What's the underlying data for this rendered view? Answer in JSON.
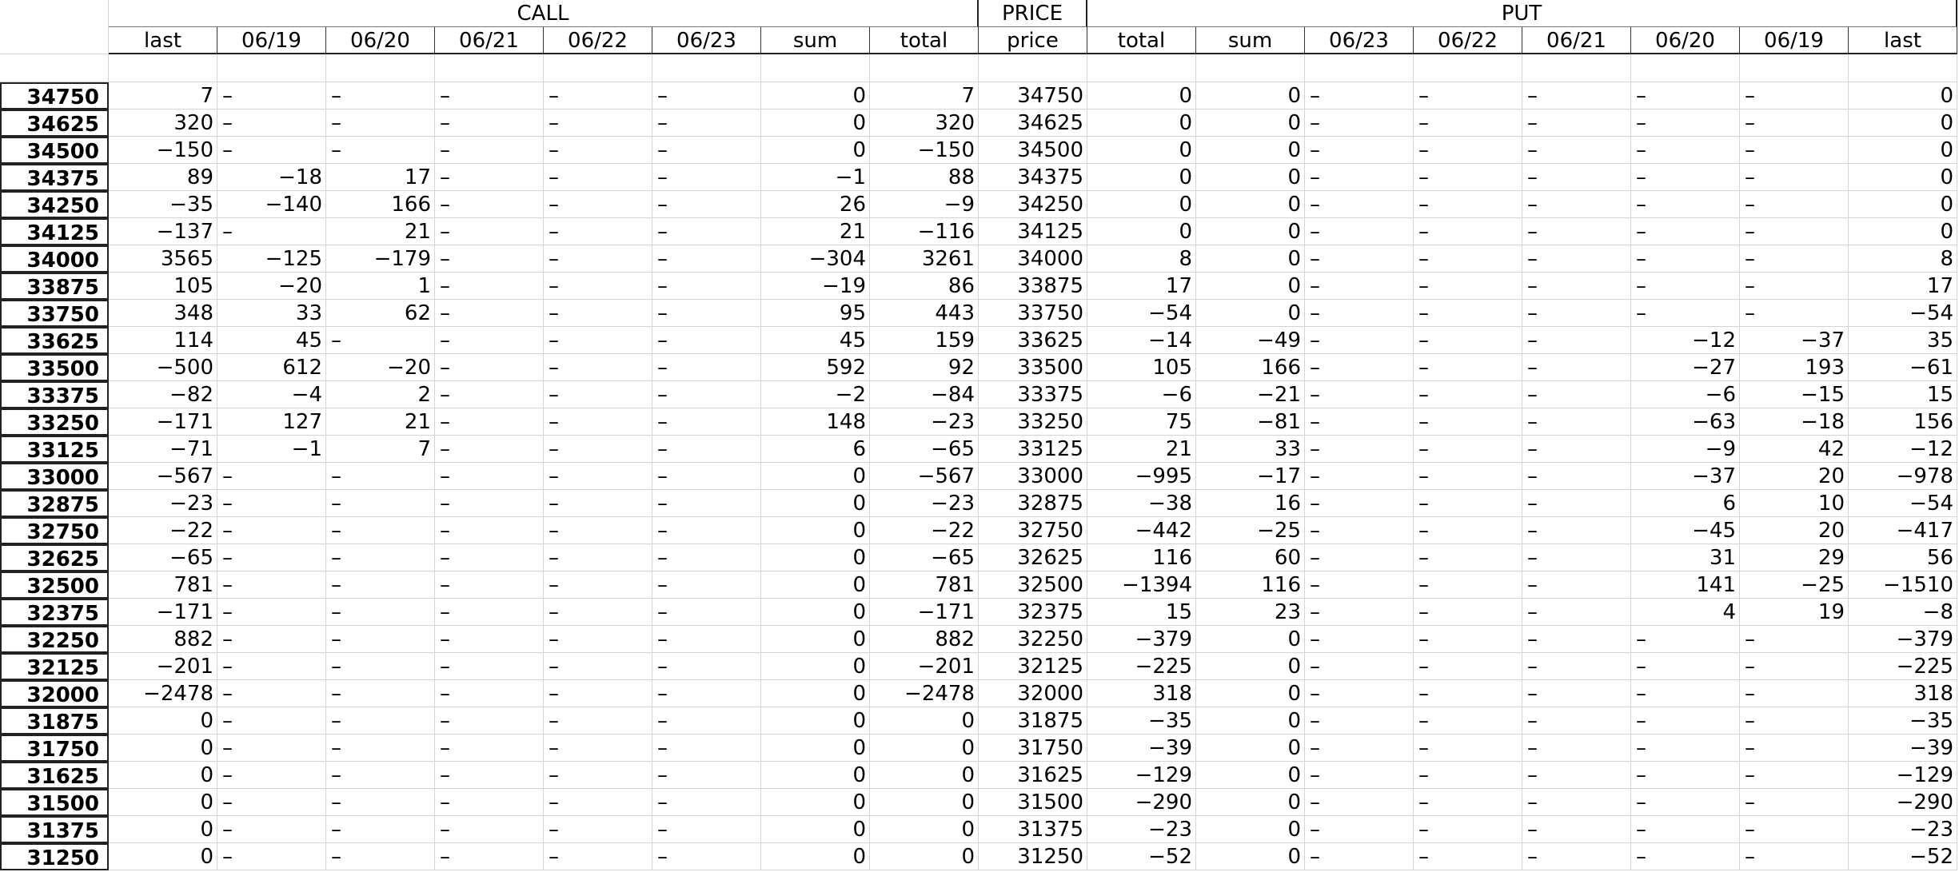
{
  "groups": [
    "CALL",
    "PRICE",
    "PUT"
  ],
  "subheaders": [
    "last",
    "06/19",
    "06/20",
    "06/21",
    "06/22",
    "06/23",
    "sum",
    "total",
    "price",
    "total",
    "sum",
    "06/23",
    "06/22",
    "06/21",
    "06/20",
    "06/19",
    "last"
  ],
  "rows": [
    {
      "k": "34750",
      "c": [
        "7",
        "–",
        "–",
        "–",
        "–",
        "–",
        "0",
        "7",
        "34750",
        "0",
        "0",
        "–",
        "–",
        "–",
        "–",
        "–",
        "0"
      ]
    },
    {
      "k": "34625",
      "c": [
        "320",
        "–",
        "–",
        "–",
        "–",
        "–",
        "0",
        "320",
        "34625",
        "0",
        "0",
        "–",
        "–",
        "–",
        "–",
        "–",
        "0"
      ]
    },
    {
      "k": "34500",
      "c": [
        "-150",
        "–",
        "–",
        "–",
        "–",
        "–",
        "0",
        "-150",
        "34500",
        "0",
        "0",
        "–",
        "–",
        "–",
        "–",
        "–",
        "0"
      ]
    },
    {
      "k": "34375",
      "c": [
        "89",
        "-18",
        "17",
        "–",
        "–",
        "–",
        "-1",
        "88",
        "34375",
        "0",
        "0",
        "–",
        "–",
        "–",
        "–",
        "–",
        "0"
      ]
    },
    {
      "k": "34250",
      "c": [
        "-35",
        "-140",
        "166",
        "–",
        "–",
        "–",
        "26",
        "-9",
        "34250",
        "0",
        "0",
        "–",
        "–",
        "–",
        "–",
        "–",
        "0"
      ]
    },
    {
      "k": "34125",
      "c": [
        "-137",
        "–",
        "21",
        "–",
        "–",
        "–",
        "21",
        "-116",
        "34125",
        "0",
        "0",
        "–",
        "–",
        "–",
        "–",
        "–",
        "0"
      ]
    },
    {
      "k": "34000",
      "c": [
        "3565",
        "-125",
        "-179",
        "–",
        "–",
        "–",
        "-304",
        "3261",
        "34000",
        "8",
        "0",
        "–",
        "–",
        "–",
        "–",
        "–",
        "8"
      ]
    },
    {
      "k": "33875",
      "c": [
        "105",
        "-20",
        "1",
        "–",
        "–",
        "–",
        "-19",
        "86",
        "33875",
        "17",
        "0",
        "–",
        "–",
        "–",
        "–",
        "–",
        "17"
      ]
    },
    {
      "k": "33750",
      "c": [
        "348",
        "33",
        "62",
        "–",
        "–",
        "–",
        "95",
        "443",
        "33750",
        "-54",
        "0",
        "–",
        "–",
        "–",
        "–",
        "–",
        "-54"
      ]
    },
    {
      "k": "33625",
      "c": [
        "114",
        "45",
        "–",
        "–",
        "–",
        "–",
        "45",
        "159",
        "33625",
        "-14",
        "-49",
        "–",
        "–",
        "–",
        "-12",
        "-37",
        "35"
      ]
    },
    {
      "k": "33500",
      "c": [
        "-500",
        "612",
        "-20",
        "–",
        "–",
        "–",
        "592",
        "92",
        "33500",
        "105",
        "166",
        "–",
        "–",
        "–",
        "-27",
        "193",
        "-61"
      ]
    },
    {
      "k": "33375",
      "c": [
        "-82",
        "-4",
        "2",
        "–",
        "–",
        "–",
        "-2",
        "-84",
        "33375",
        "-6",
        "-21",
        "–",
        "–",
        "–",
        "-6",
        "-15",
        "15"
      ]
    },
    {
      "k": "33250",
      "c": [
        "-171",
        "127",
        "21",
        "–",
        "–",
        "–",
        "148",
        "-23",
        "33250",
        "75",
        "-81",
        "–",
        "–",
        "–",
        "-63",
        "-18",
        "156"
      ]
    },
    {
      "k": "33125",
      "c": [
        "-71",
        "-1",
        "7",
        "–",
        "–",
        "–",
        "6",
        "-65",
        "33125",
        "21",
        "33",
        "–",
        "–",
        "–",
        "-9",
        "42",
        "-12"
      ]
    },
    {
      "k": "33000",
      "c": [
        "-567",
        "–",
        "–",
        "–",
        "–",
        "–",
        "0",
        "-567",
        "33000",
        "-995",
        "-17",
        "–",
        "–",
        "–",
        "-37",
        "20",
        "-978"
      ]
    },
    {
      "k": "32875",
      "c": [
        "-23",
        "–",
        "–",
        "–",
        "–",
        "–",
        "0",
        "-23",
        "32875",
        "-38",
        "16",
        "–",
        "–",
        "–",
        "6",
        "10",
        "-54"
      ]
    },
    {
      "k": "32750",
      "c": [
        "-22",
        "–",
        "–",
        "–",
        "–",
        "–",
        "0",
        "-22",
        "32750",
        "-442",
        "-25",
        "–",
        "–",
        "–",
        "-45",
        "20",
        "-417"
      ]
    },
    {
      "k": "32625",
      "c": [
        "-65",
        "–",
        "–",
        "–",
        "–",
        "–",
        "0",
        "-65",
        "32625",
        "116",
        "60",
        "–",
        "–",
        "–",
        "31",
        "29",
        "56"
      ]
    },
    {
      "k": "32500",
      "c": [
        "781",
        "–",
        "–",
        "–",
        "–",
        "–",
        "0",
        "781",
        "32500",
        "-1394",
        "116",
        "–",
        "–",
        "–",
        "141",
        "-25",
        "-1510"
      ]
    },
    {
      "k": "32375",
      "c": [
        "-171",
        "–",
        "–",
        "–",
        "–",
        "–",
        "0",
        "-171",
        "32375",
        "15",
        "23",
        "–",
        "–",
        "–",
        "4",
        "19",
        "-8"
      ]
    },
    {
      "k": "32250",
      "c": [
        "882",
        "–",
        "–",
        "–",
        "–",
        "–",
        "0",
        "882",
        "32250",
        "-379",
        "0",
        "–",
        "–",
        "–",
        "–",
        "–",
        "-379"
      ]
    },
    {
      "k": "32125",
      "c": [
        "-201",
        "–",
        "–",
        "–",
        "–",
        "–",
        "0",
        "-201",
        "32125",
        "-225",
        "0",
        "–",
        "–",
        "–",
        "–",
        "–",
        "-225"
      ]
    },
    {
      "k": "32000",
      "c": [
        "-2478",
        "–",
        "–",
        "–",
        "–",
        "–",
        "0",
        "-2478",
        "32000",
        "318",
        "0",
        "–",
        "–",
        "–",
        "–",
        "–",
        "318"
      ]
    },
    {
      "k": "31875",
      "c": [
        "0",
        "–",
        "–",
        "–",
        "–",
        "–",
        "0",
        "0",
        "31875",
        "-35",
        "0",
        "–",
        "–",
        "–",
        "–",
        "–",
        "-35"
      ]
    },
    {
      "k": "31750",
      "c": [
        "0",
        "–",
        "–",
        "–",
        "–",
        "–",
        "0",
        "0",
        "31750",
        "-39",
        "0",
        "–",
        "–",
        "–",
        "–",
        "–",
        "-39"
      ]
    },
    {
      "k": "31625",
      "c": [
        "0",
        "–",
        "–",
        "–",
        "–",
        "–",
        "0",
        "0",
        "31625",
        "-129",
        "0",
        "–",
        "–",
        "–",
        "–",
        "–",
        "-129"
      ]
    },
    {
      "k": "31500",
      "c": [
        "0",
        "–",
        "–",
        "–",
        "–",
        "–",
        "0",
        "0",
        "31500",
        "-290",
        "0",
        "–",
        "–",
        "–",
        "–",
        "–",
        "-290"
      ]
    },
    {
      "k": "31375",
      "c": [
        "0",
        "–",
        "–",
        "–",
        "–",
        "–",
        "0",
        "0",
        "31375",
        "-23",
        "0",
        "–",
        "–",
        "–",
        "–",
        "–",
        "-23"
      ]
    },
    {
      "k": "31250",
      "c": [
        "0",
        "–",
        "–",
        "–",
        "–",
        "–",
        "0",
        "0",
        "31250",
        "-52",
        "0",
        "–",
        "–",
        "–",
        "–",
        "–",
        "-52"
      ]
    }
  ]
}
